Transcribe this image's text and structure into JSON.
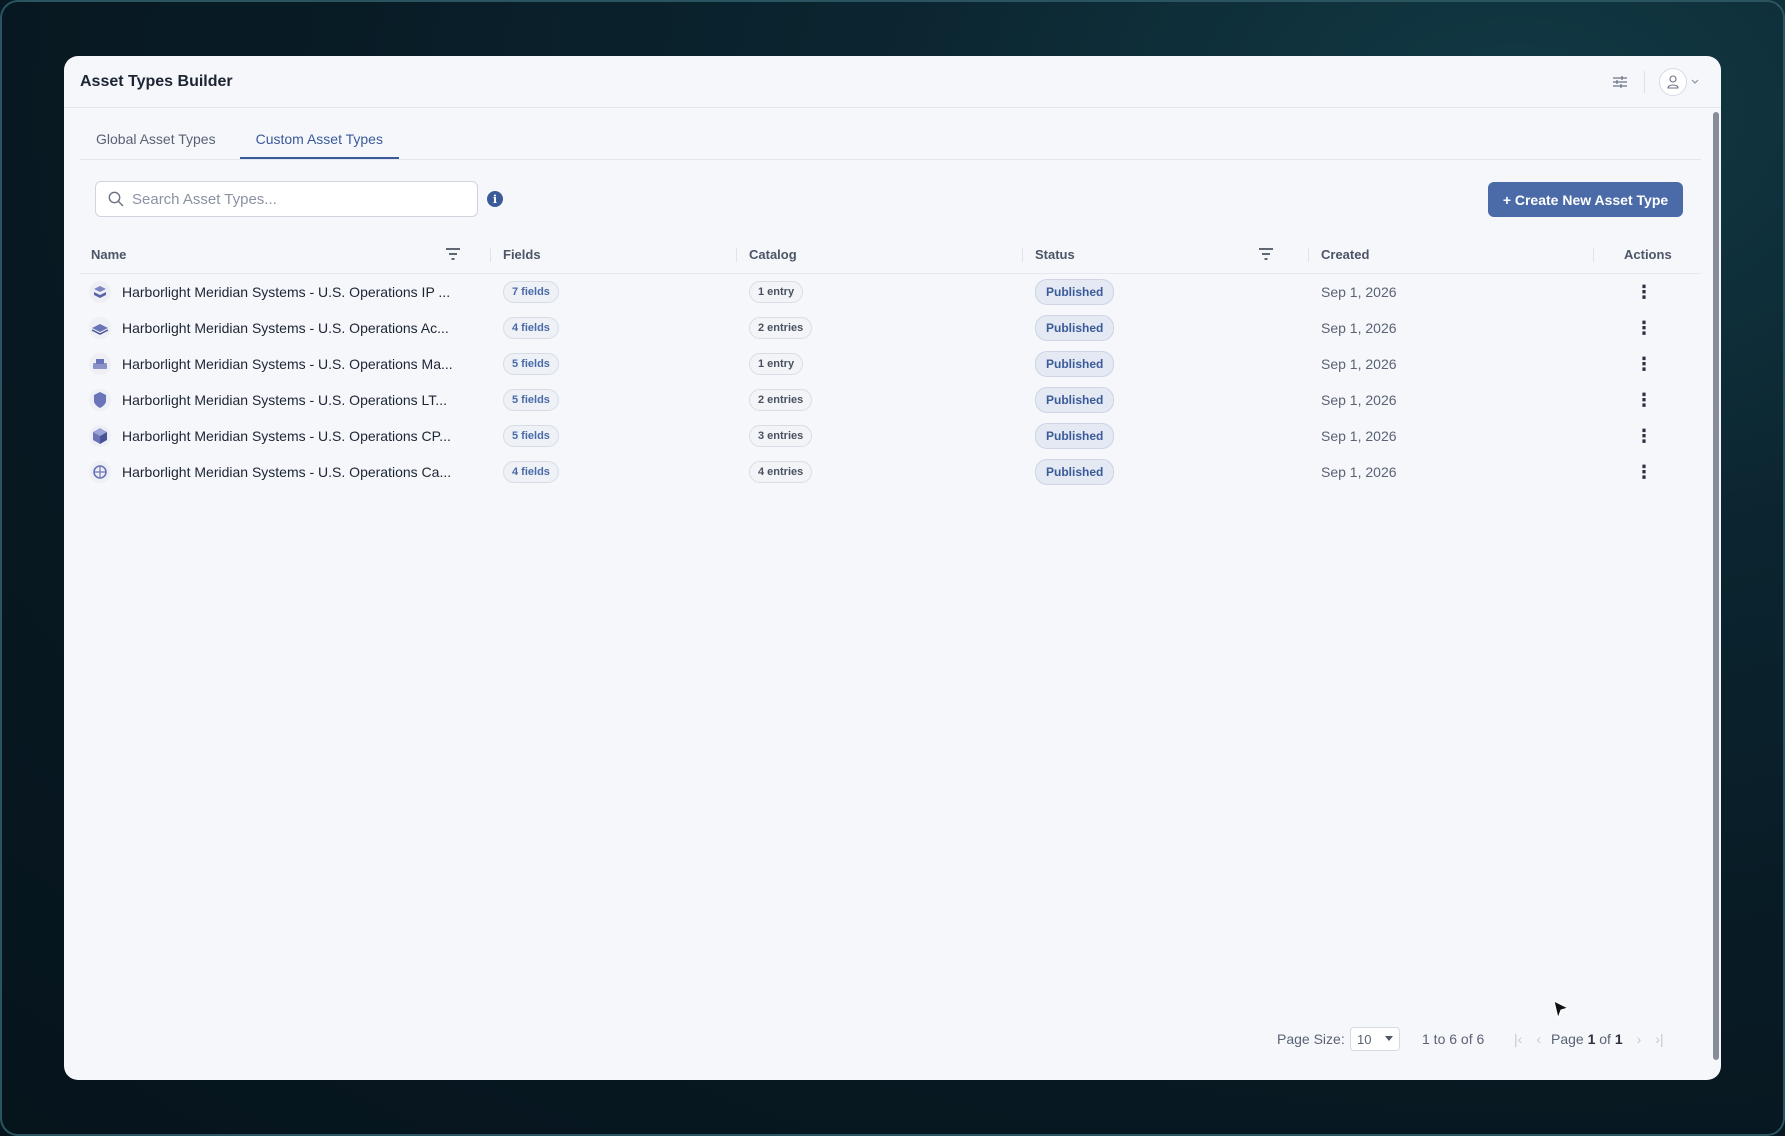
{
  "app": {
    "title": "Asset Types Builder"
  },
  "tabs": [
    {
      "label": "Global Asset Types",
      "active": false
    },
    {
      "label": "Custom Asset Types",
      "active": true
    }
  ],
  "search": {
    "placeholder": "Search Asset Types...",
    "value": ""
  },
  "toolbar": {
    "create_label": "+ Create New Asset Type"
  },
  "table": {
    "columns": [
      "Name",
      "Fields",
      "Catalog",
      "Status",
      "Created",
      "Actions"
    ],
    "rows": [
      {
        "name": "Harborlight Meridian Systems - U.S. Operations IP ...",
        "fields": "7 fields",
        "catalog": "1 entry",
        "status": "Published",
        "created": "Sep 1, 2026",
        "icon": "stack-icon"
      },
      {
        "name": "Harborlight Meridian Systems - U.S. Operations Ac...",
        "fields": "4 fields",
        "catalog": "2 entries",
        "status": "Published",
        "created": "Sep 1, 2026",
        "icon": "layers-icon"
      },
      {
        "name": "Harborlight Meridian Systems - U.S. Operations Ma...",
        "fields": "5 fields",
        "catalog": "1 entry",
        "status": "Published",
        "created": "Sep 1, 2026",
        "icon": "machine-icon"
      },
      {
        "name": "Harborlight Meridian Systems - U.S. Operations LT...",
        "fields": "5 fields",
        "catalog": "2 entries",
        "status": "Published",
        "created": "Sep 1, 2026",
        "icon": "shield-icon"
      },
      {
        "name": "Harborlight Meridian Systems - U.S. Operations CP...",
        "fields": "5 fields",
        "catalog": "3 entries",
        "status": "Published",
        "created": "Sep 1, 2026",
        "icon": "cube-icon"
      },
      {
        "name": "Harborlight Meridian Systems - U.S. Operations Ca...",
        "fields": "4 fields",
        "catalog": "4 entries",
        "status": "Published",
        "created": "Sep 1, 2026",
        "icon": "globe-icon"
      }
    ]
  },
  "pagination": {
    "page_size_label": "Page Size:",
    "page_size": "10",
    "range": "1 to 6 of 6",
    "page_prefix": "Page",
    "page_current": "1",
    "page_of": "of",
    "page_total": "1"
  },
  "colors": {
    "accent": "#4a6aa8",
    "background": "#f5f7fb"
  }
}
